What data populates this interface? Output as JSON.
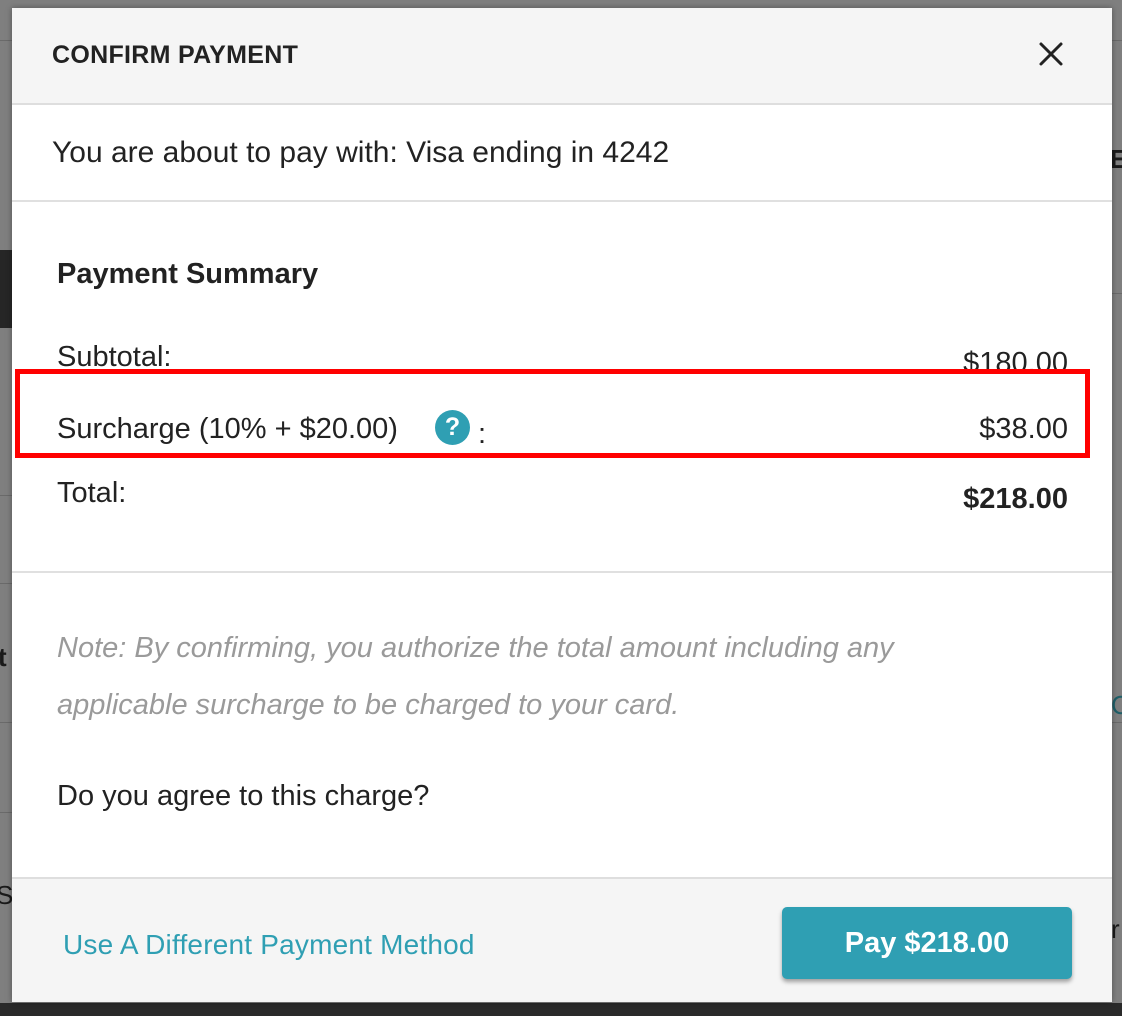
{
  "background_fragments": {
    "letter_e": "E",
    "letter_t": "t",
    "letter_s": "S",
    "letter_c": "C",
    "letter_r": "r"
  },
  "modal": {
    "title": "CONFIRM PAYMENT",
    "close_icon": "close-icon",
    "pay_with": "You are about to pay with: Visa ending in 4242",
    "summary": {
      "heading": "Payment Summary",
      "subtotal_label": "Subtotal:",
      "subtotal_value": "$180.00",
      "surcharge_label": "Surcharge (10% + $20.00)",
      "surcharge_help_icon": "question-circle-icon",
      "surcharge_help_glyph": "?",
      "surcharge_colon": ":",
      "surcharge_value": "$38.00",
      "total_label": "Total:",
      "total_value": "$218.00"
    },
    "note": "Note: By confirming, you authorize the total amount including any applicable surcharge to be charged to your card.",
    "question": "Do you agree to this charge?",
    "footer": {
      "different_method_link": "Use A Different Payment Method",
      "pay_button": "Pay $218.00"
    }
  },
  "colors": {
    "accent": "#2f9fb3",
    "highlight": "#ff0000",
    "overlay": "#7f7f7f",
    "note_text": "#9a9a9a"
  }
}
